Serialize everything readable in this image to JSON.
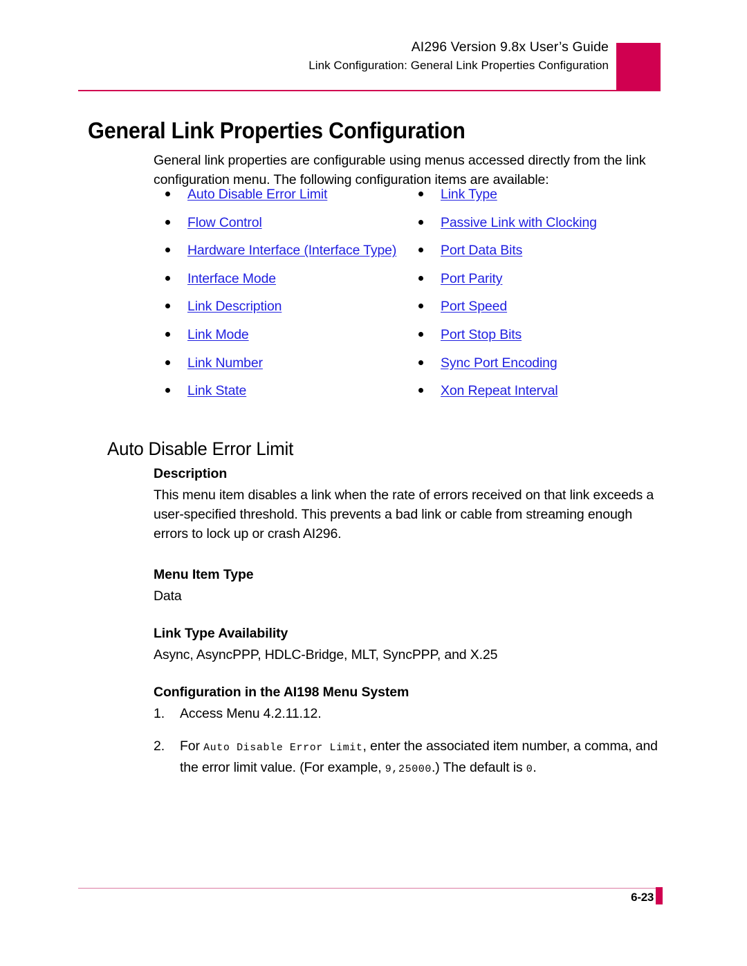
{
  "header": {
    "title_line1": "AI296 Version 9.8x User’s Guide",
    "title_line2": "Link Configuration: General Link Properties Configuration",
    "accent_color": "#d00050"
  },
  "title": "General Link Properties Configuration",
  "intro": "General link properties are configurable using menus accessed directly from the link configuration menu. The following configuration items are available:",
  "link_list": {
    "link_color": "#1f1fe0",
    "left_column": [
      "Auto Disable Error Limit",
      "Flow Control",
      "Hardware Interface (Interface Type)",
      "Interface Mode",
      "Link Description",
      "Link Mode",
      "Link Number",
      "Link State"
    ],
    "right_column": [
      "Link Type",
      "Passive Link with Clocking",
      "Port Data Bits",
      "Port Parity",
      "Port Speed",
      "Port Stop Bits",
      "Sync Port Encoding",
      "Xon Repeat Interval"
    ]
  },
  "section": {
    "heading": "Auto Disable Error Limit",
    "description_label": "Description",
    "description_text": "This menu item disables a link when the rate of errors received on that link exceeds a user-specified threshold. This prevents a bad link or cable from streaming enough errors to lock up or crash AI296.",
    "menu_item_type_label": "Menu Item Type",
    "menu_item_type_value": "Data",
    "link_type_availability_label": "Link Type Availability",
    "link_type_availability_value": "Async, AsyncPPP, HDLC-Bridge, MLT, SyncPPP, and X.25",
    "configuration_label": "Configuration in the AI198 Menu System",
    "steps": [
      {
        "number": "1.",
        "text": "Access Menu 4.2.11.12."
      },
      {
        "number": "2.",
        "prefix": "For ",
        "mono1": "Auto Disable Error Limit",
        "middle": ", enter the associated item number, a comma, and the error limit value. (For example, ",
        "mono2": "9,25000",
        "middle2": ".) The default is ",
        "mono3": "0",
        "suffix": "."
      }
    ]
  },
  "footer": {
    "page_number": "6-23",
    "accent_color": "#d00050",
    "rule_color": "#dd7aa2"
  }
}
